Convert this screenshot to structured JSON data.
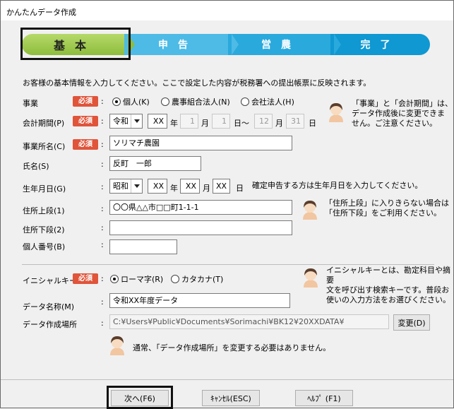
{
  "window": {
    "title": "かんたんデータ作成"
  },
  "steps": [
    "基本",
    "申告",
    "営農",
    "完了"
  ],
  "intro": "お客様の基本情報を入力してください。ここで設定した内容が税務署への提出帳票に反映されます。",
  "required_label": "必須",
  "business": {
    "label": "事業",
    "options": [
      "個人(K)",
      "農事組合法人(N)",
      "会社法人(H)"
    ],
    "selected": "個人(K)"
  },
  "period": {
    "label": "会計期間(P)",
    "era": "令和",
    "year": "XX",
    "year_unit": "年",
    "start_month": "1",
    "month_unit": "月",
    "start_day": "1",
    "day_range": "日～",
    "end_month": "12",
    "end_day": "31",
    "day_unit": "日"
  },
  "period_note": [
    "「事業」と「会計期間」は、",
    "データ作成後に変更できま",
    "せん。ご注意ください。"
  ],
  "office_name": {
    "label": "事業所名(C)",
    "value": "ソリマチ農園"
  },
  "person_name": {
    "label": "氏名(S)",
    "value": "反町　一郎"
  },
  "birth": {
    "label": "生年月日(G)",
    "era": "昭和",
    "year": "XX",
    "month": "XX",
    "day": "XX",
    "note": "確定申告する方は生年月日を入力してください。"
  },
  "address1": {
    "label": "住所上段(1)",
    "value": "〇〇県△△市□□町1-1-1"
  },
  "address2": {
    "label": "住所下段(2)",
    "value": ""
  },
  "personal_number": {
    "label": "個人番号(B)",
    "value": ""
  },
  "address_note": [
    "「住所上段」に入りきらない場合は",
    "「住所下段」をご利用ください。"
  ],
  "initial_key": {
    "label": "イニシャルキー",
    "options": [
      "ローマ字(R)",
      "カタカナ(T)"
    ],
    "selected": "ローマ字(R)"
  },
  "initial_note": [
    "イニシャルキーとは、勘定科目や摘要",
    "文を呼び出す検索キーです。普段お",
    "使いの入力方法をお選びください。"
  ],
  "data_name": {
    "label": "データ名称(M)",
    "value": "令和XX年度データ"
  },
  "data_location": {
    "label": "データ作成場所",
    "value": "C:¥Users¥Public¥Documents¥Sorimachi¥BK12¥20XXDATA¥",
    "change_button": "変更(D)"
  },
  "location_note": "通常、「データ作成場所」を変更する必要はありません。",
  "buttons": {
    "next": "次へ(F6)",
    "cancel": "ｷｬﾝｾﾙ(ESC)",
    "help": "ﾍﾙﾌﾟ (F1)"
  },
  "colors": {
    "required": "#e0543a",
    "step_active": "#8dbd3c",
    "step_inactive": "#2aa9dc"
  }
}
